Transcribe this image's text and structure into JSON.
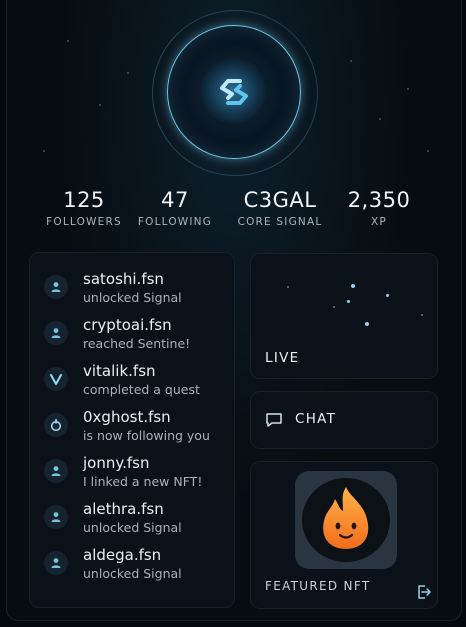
{
  "profile": {
    "logo_icon": "signal-s-logo-icon",
    "accent_color": "#6fc6e8"
  },
  "stats": [
    {
      "value": "125",
      "label": "FOLLOWERS"
    },
    {
      "value": "47",
      "label": "FOLLOWING"
    },
    {
      "value": "C3GAL",
      "label": "CORE SIGNAL"
    },
    {
      "value": "2,350",
      "label": "XP"
    }
  ],
  "activity": [
    {
      "name": "satoshi.fsn",
      "text": "unlocked Signal",
      "icon": "user-icon"
    },
    {
      "name": "cryptoai.fsn",
      "text": "reached Sentine!",
      "icon": "user-icon"
    },
    {
      "name": "vitalik.fsn",
      "text": "completed a quest",
      "icon": "v-icon"
    },
    {
      "name": "0xghost.fsn",
      "text": "is now following you",
      "icon": "power-icon"
    },
    {
      "name": "jonny.fsn",
      "text": "I linked a new NFT!",
      "icon": "user-icon"
    },
    {
      "name": "alethra.fsn",
      "text": "unlocked Signal",
      "icon": "user-icon"
    },
    {
      "name": "aldega.fsn",
      "text": "unlocked Signal",
      "icon": "user-icon"
    }
  ],
  "cards": {
    "live_label": "LIVE",
    "chat_label": "CHAT",
    "chat_icon": "chat-bubble-icon",
    "featured_label": "FEATURED NFT",
    "featured_icon": "flame-face-icon",
    "exit_icon": "exit-icon"
  }
}
